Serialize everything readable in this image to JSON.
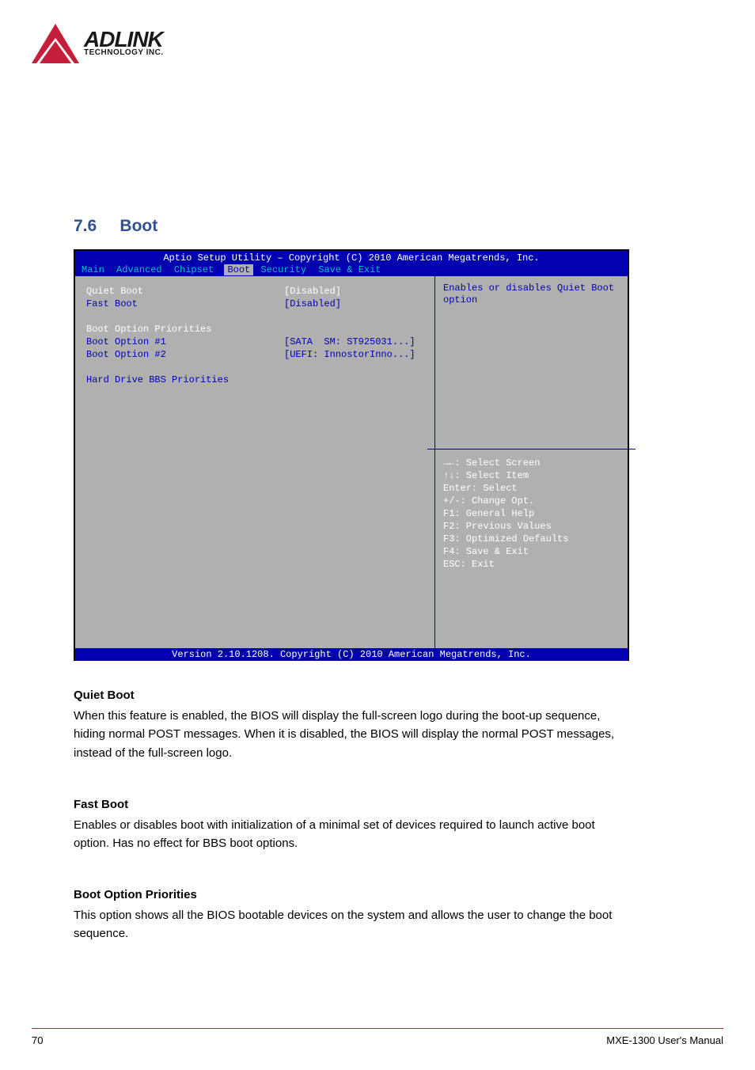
{
  "logo": {
    "main": "ADLINK",
    "sub": "TECHNOLOGY INC."
  },
  "section": {
    "number": "7.6",
    "title": "Boot"
  },
  "bios": {
    "title": "Aptio Setup Utility – Copyright (C) 2010 American Megatrends, Inc.",
    "tabs": [
      "Main",
      "Advanced",
      "Chipset",
      "Boot",
      "Security",
      "Save & Exit"
    ],
    "active_tab": "Boot",
    "rows": [
      {
        "label": "Quiet Boot",
        "value": "[Disabled]",
        "style": "white"
      },
      {
        "label": "Fast Boot",
        "value": "[Disabled]",
        "style": "blue"
      },
      {
        "label": "",
        "value": "",
        "style": "blank"
      },
      {
        "label": "Boot Option Priorities",
        "value": "",
        "style": "heading"
      },
      {
        "label": "Boot Option #1",
        "value": "[SATA  SM: ST925031...]",
        "style": "blue"
      },
      {
        "label": "Boot Option #2",
        "value": "[UEFI: InnostorInno...]",
        "style": "blue"
      },
      {
        "label": "",
        "value": "",
        "style": "blank"
      },
      {
        "label": "Hard Drive BBS Priorities",
        "value": "",
        "style": "blue"
      }
    ],
    "help": "Enables or disables Quiet Boot option",
    "keys": "→←: Select Screen\n↑↓: Select Item\nEnter: Select\n+/-: Change Opt.\nF1: General Help\nF2: Previous Values\nF3: Optimized Defaults\nF4: Save & Exit\nESC: Exit",
    "footer": "Version 2.10.1208. Copyright (C) 2010 American Megatrends, Inc."
  },
  "options": {
    "quiet": {
      "title": "Quiet Boot",
      "body": "When this feature is enabled, the BIOS will display the full-screen logo during the boot-up sequence, hiding normal POST messages. When it is disabled, the BIOS will display the normal POST messages, instead of the full-screen logo."
    },
    "fast": {
      "title": "Fast Boot",
      "body": "Enables or disables boot with initialization of a minimal set of devices required to launch active boot option. Has no effect for BBS boot options."
    },
    "prio": {
      "title": "Boot Option Priorities",
      "body": "This option shows all the BIOS bootable devices on the system and allows the user to change the boot sequence."
    }
  },
  "footer": {
    "page": "70",
    "doc": "MXE-1300 User's Manual"
  }
}
